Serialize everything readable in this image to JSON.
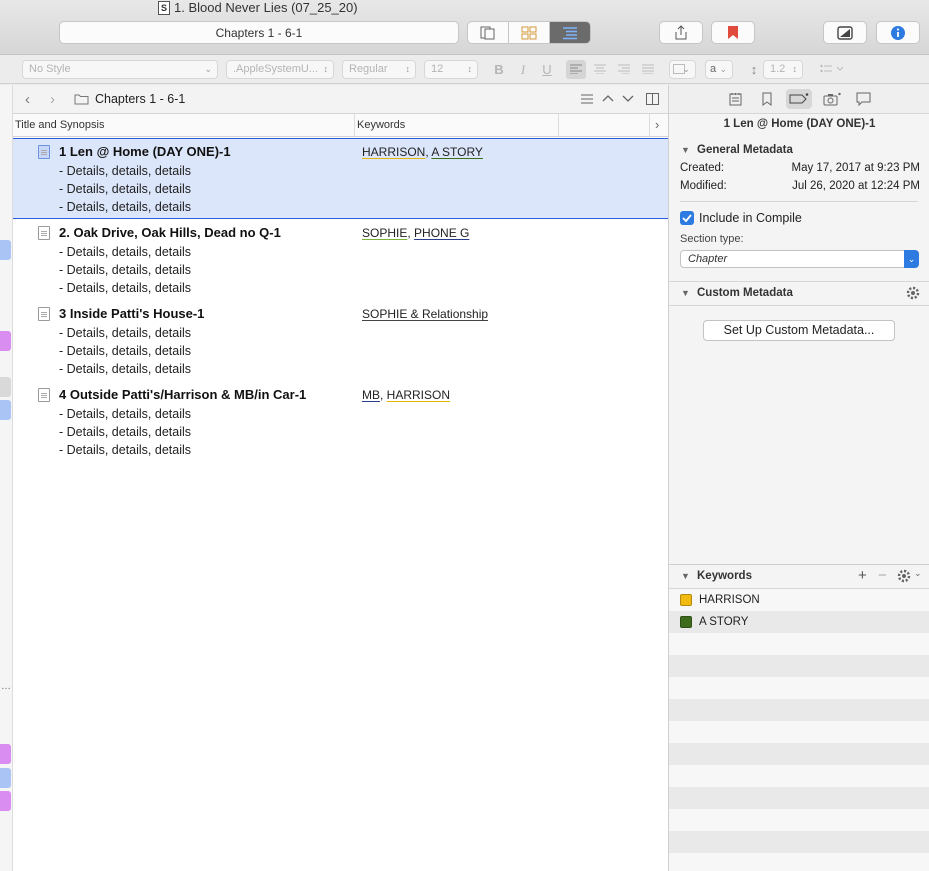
{
  "window": {
    "title": "1. Blood Never Lies (07_25_20)",
    "doc_badge": "S"
  },
  "toolbar": {
    "navigation_title": "Chapters 1 - 6-1",
    "view_modes": [
      "scrivenings-icon",
      "corkboard-icon",
      "outliner-icon"
    ],
    "active_view": "outliner"
  },
  "formatbar": {
    "style": "No Style",
    "font": ".AppleSystemU...",
    "weight": "Regular",
    "size": "12",
    "bold": "B",
    "italic": "I",
    "underline": "U",
    "color_picker": "a",
    "line_spacing": "1.2"
  },
  "editor": {
    "header_title": "Chapters 1 - 6-1",
    "columns": {
      "title": "Title and Synopsis",
      "keywords": "Keywords"
    },
    "rows": [
      {
        "title": "1 Len @ Home (DAY ONE)-1",
        "synopsis": [
          "- Details, details, details",
          "- Details, details, details",
          "- Details, details, details"
        ],
        "keywords": [
          {
            "text": "HARRISON",
            "color": "#e3b40c"
          },
          {
            "text": "A STORY",
            "color": "#3c6e1a"
          }
        ],
        "selected": true
      },
      {
        "title": "2. Oak Drive, Oak Hills, Dead no Q-1",
        "synopsis": [
          "- Details, details, details",
          "- Details, details, details",
          "- Details, details, details"
        ],
        "keywords": [
          {
            "text": "SOPHIE",
            "color": "#7bb33a"
          },
          {
            "text": "PHONE G",
            "color": "#2a3e8e"
          }
        ],
        "selected": false
      },
      {
        "title": "3 Inside Patti's House-1",
        "synopsis": [
          "- Details, details, details",
          "- Details, details, details",
          "- Details, details, details"
        ],
        "keywords": [
          {
            "text": "SOPHIE & Relationship",
            "color": "#444444"
          }
        ],
        "selected": false
      },
      {
        "title": "4 Outside Patti's/Harrison & MB/in Car-1",
        "synopsis": [
          "- Details, details, details",
          "- Details, details, details",
          "- Details, details, details"
        ],
        "keywords": [
          {
            "text": "MB",
            "color": "#2a3e8e"
          },
          {
            "text": "HARRISON",
            "color": "#e3b40c"
          }
        ],
        "selected": false
      }
    ]
  },
  "inspector": {
    "doc_title": "1 Len @ Home (DAY ONE)-1",
    "general": {
      "heading": "General Metadata",
      "created_label": "Created:",
      "created_value": "May 17, 2017 at 9:23 PM",
      "modified_label": "Modified:",
      "modified_value": "Jul 26, 2020 at 12:24 PM",
      "include_label": "Include in Compile",
      "include_checked": true,
      "section_type_label": "Section type:",
      "section_type_value": "Chapter"
    },
    "custom": {
      "heading": "Custom Metadata",
      "setup_button": "Set Up Custom Metadata..."
    },
    "keywords": {
      "heading": "Keywords",
      "items": [
        {
          "label": "HARRISON",
          "color": "#f2b90f"
        },
        {
          "label": "A STORY",
          "color": "#3e6b1c"
        }
      ]
    }
  },
  "left_strip": {
    "marks": [
      "#a9c4f5",
      "#d98df0",
      "#d9d9d9",
      "#a9c4f5",
      "#d98df0",
      "#a9c4f5",
      "#d98df0"
    ]
  }
}
